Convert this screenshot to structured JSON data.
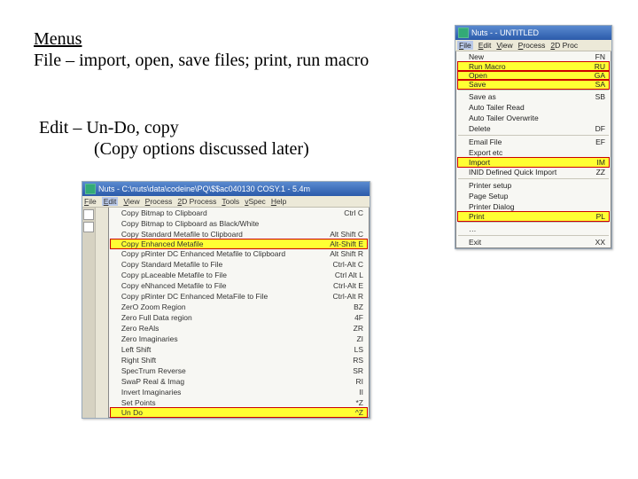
{
  "text": {
    "heading": "Menus",
    "file_line": "File – import, open, save files; print, run macro",
    "edit_line1": "Edit – Un-Do, copy",
    "edit_line2": "(Copy options discussed later)"
  },
  "app_right": {
    "title": "Nuts -  - UNTITLED",
    "menubar": [
      "File",
      "Edit",
      "View",
      "Process",
      "2D Proc"
    ],
    "items": [
      {
        "label": "New",
        "sc": "FN"
      },
      {
        "label": "Run  Macro",
        "sc": "RU",
        "hl": true
      },
      {
        "label": "Open",
        "sc": "GA",
        "hl": true
      },
      {
        "label": "Save",
        "sc": "SA",
        "hl": true
      },
      {
        "sep": true
      },
      {
        "label": "Save as",
        "sc": "SB"
      },
      {
        "label": "Auto Tailer Read",
        "sc": ""
      },
      {
        "label": "Auto Tailer Overwrite",
        "sc": ""
      },
      {
        "label": "Delete",
        "sc": "DF"
      },
      {
        "sep": true
      },
      {
        "label": "Email File",
        "sc": "EF"
      },
      {
        "label": "Export etc",
        "sc": ""
      },
      {
        "label": "Import",
        "sc": "IM",
        "hl": true
      },
      {
        "label": "INID Defined Quick Import",
        "sc": "ZZ"
      },
      {
        "sep": true
      },
      {
        "label": "Printer setup",
        "sc": ""
      },
      {
        "label": "Page Setup",
        "sc": ""
      },
      {
        "label": "Printer Dialog",
        "sc": ""
      },
      {
        "label": "Print",
        "sc": "PL",
        "hl": true
      },
      {
        "sep": true
      },
      {
        "label": "…",
        "sc": ""
      },
      {
        "sep": true
      },
      {
        "label": "Exit",
        "sc": "XX"
      }
    ]
  },
  "app_left": {
    "title": "Nuts - C:\\nuts\\data\\codeine\\PQ\\$$ac040130  COSY.1 - 5.4m",
    "menubar": [
      "File",
      "Edit",
      "View",
      "Process",
      "2D Process",
      "Tools",
      "vSpec",
      "Help"
    ],
    "items": [
      {
        "label": "Copy Bitmap to Clipboard",
        "sc": "Ctrl C"
      },
      {
        "label": "Copy Bitmap to Clipboard as Black/White",
        "sc": ""
      },
      {
        "label": "Copy Standard Metafile to Clipboard",
        "sc": "Alt Shift C"
      },
      {
        "label": "Copy Enhanced Metafile",
        "sc": "Alt-Shift E",
        "hl": true
      },
      {
        "label": "Copy pRinter DC Enhanced Metafile to Clipboard",
        "sc": "Alt Shift R"
      },
      {
        "label": "Copy Standard Metafile to File",
        "sc": "Ctrl-Alt C"
      },
      {
        "label": "Copy pLaceable Metafile to File",
        "sc": "Ctrl  Alt L"
      },
      {
        "label": "Copy eNhanced Metafile to File",
        "sc": "Ctrl-Alt E"
      },
      {
        "label": "Copy pRinter DC Enhanced MetaFile to File",
        "sc": "Ctrl-Alt R"
      },
      {
        "label": "ZerO Zoom Region",
        "sc": "BZ"
      },
      {
        "label": "Zero Full Data region",
        "sc": "4F"
      },
      {
        "label": "Zero ReAls",
        "sc": "ZR"
      },
      {
        "label": "Zero Imaginaries",
        "sc": "ZI"
      },
      {
        "label": "Left Shift",
        "sc": "LS"
      },
      {
        "label": "Right Shift",
        "sc": "RS"
      },
      {
        "label": "SpecTrum Reverse",
        "sc": "SR"
      },
      {
        "label": "SwaP Real & Imag",
        "sc": "RI"
      },
      {
        "label": "Invert Imaginaries",
        "sc": "II"
      },
      {
        "label": "Set Points",
        "sc": "*Z"
      },
      {
        "label": "Un Do",
        "sc": "^Z",
        "hl": true
      }
    ]
  }
}
